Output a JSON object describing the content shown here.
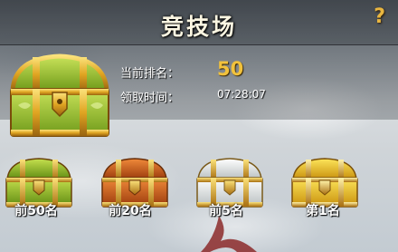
{
  "title": "竞技场",
  "help_icon": "?",
  "info": {
    "rank_label": "当前排名：",
    "rank_value": "50",
    "time_label": "领取时间：",
    "time_value": "07:28:07"
  },
  "main_chest": {
    "icon": "green-treasure-chest-icon"
  },
  "rewards": [
    {
      "label": "前50名",
      "icon": "green-chest-icon",
      "color": "#8dbb2a"
    },
    {
      "label": "前20名",
      "icon": "orange-chest-icon",
      "color": "#d2601c"
    },
    {
      "label": "前5名",
      "icon": "white-chest-icon",
      "color": "#e8ece8"
    },
    {
      "label": "第1名",
      "icon": "gold-chest-icon",
      "color": "#f0c21e"
    }
  ],
  "colors": {
    "accent_gold": "#f2c23c",
    "title_text": "#fbf6e2"
  }
}
